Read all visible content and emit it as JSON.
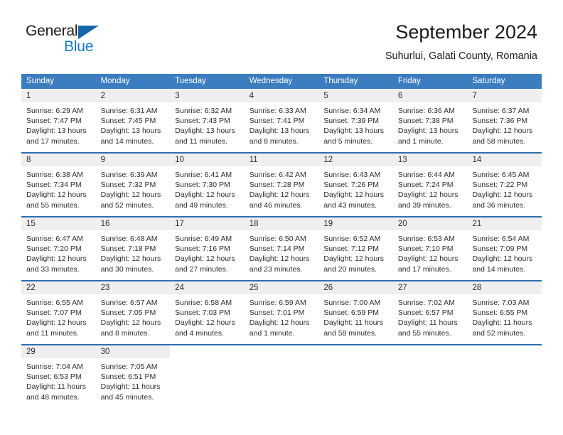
{
  "brand": {
    "word1": "General",
    "word2": "Blue",
    "flag_icon": "triangle-flag-icon",
    "accent_color": "#1878c8"
  },
  "header": {
    "title": "September 2024",
    "subtitle": "Suhurlui, Galati County, Romania"
  },
  "theme": {
    "header_blue": "#3b7dbf",
    "row_border_blue": "#2f6fb0",
    "daynum_band": "#efefef"
  },
  "weekdays": [
    "Sunday",
    "Monday",
    "Tuesday",
    "Wednesday",
    "Thursday",
    "Friday",
    "Saturday"
  ],
  "weeks": [
    [
      {
        "day": "1",
        "sunrise": "Sunrise: 6:29 AM",
        "sunset": "Sunset: 7:47 PM",
        "daylight1": "Daylight: 13 hours",
        "daylight2": "and 17 minutes."
      },
      {
        "day": "2",
        "sunrise": "Sunrise: 6:31 AM",
        "sunset": "Sunset: 7:45 PM",
        "daylight1": "Daylight: 13 hours",
        "daylight2": "and 14 minutes."
      },
      {
        "day": "3",
        "sunrise": "Sunrise: 6:32 AM",
        "sunset": "Sunset: 7:43 PM",
        "daylight1": "Daylight: 13 hours",
        "daylight2": "and 11 minutes."
      },
      {
        "day": "4",
        "sunrise": "Sunrise: 6:33 AM",
        "sunset": "Sunset: 7:41 PM",
        "daylight1": "Daylight: 13 hours",
        "daylight2": "and 8 minutes."
      },
      {
        "day": "5",
        "sunrise": "Sunrise: 6:34 AM",
        "sunset": "Sunset: 7:39 PM",
        "daylight1": "Daylight: 13 hours",
        "daylight2": "and 5 minutes."
      },
      {
        "day": "6",
        "sunrise": "Sunrise: 6:36 AM",
        "sunset": "Sunset: 7:38 PM",
        "daylight1": "Daylight: 13 hours",
        "daylight2": "and 1 minute."
      },
      {
        "day": "7",
        "sunrise": "Sunrise: 6:37 AM",
        "sunset": "Sunset: 7:36 PM",
        "daylight1": "Daylight: 12 hours",
        "daylight2": "and 58 minutes."
      }
    ],
    [
      {
        "day": "8",
        "sunrise": "Sunrise: 6:38 AM",
        "sunset": "Sunset: 7:34 PM",
        "daylight1": "Daylight: 12 hours",
        "daylight2": "and 55 minutes."
      },
      {
        "day": "9",
        "sunrise": "Sunrise: 6:39 AM",
        "sunset": "Sunset: 7:32 PM",
        "daylight1": "Daylight: 12 hours",
        "daylight2": "and 52 minutes."
      },
      {
        "day": "10",
        "sunrise": "Sunrise: 6:41 AM",
        "sunset": "Sunset: 7:30 PM",
        "daylight1": "Daylight: 12 hours",
        "daylight2": "and 49 minutes."
      },
      {
        "day": "11",
        "sunrise": "Sunrise: 6:42 AM",
        "sunset": "Sunset: 7:28 PM",
        "daylight1": "Daylight: 12 hours",
        "daylight2": "and 46 minutes."
      },
      {
        "day": "12",
        "sunrise": "Sunrise: 6:43 AM",
        "sunset": "Sunset: 7:26 PM",
        "daylight1": "Daylight: 12 hours",
        "daylight2": "and 43 minutes."
      },
      {
        "day": "13",
        "sunrise": "Sunrise: 6:44 AM",
        "sunset": "Sunset: 7:24 PM",
        "daylight1": "Daylight: 12 hours",
        "daylight2": "and 39 minutes."
      },
      {
        "day": "14",
        "sunrise": "Sunrise: 6:45 AM",
        "sunset": "Sunset: 7:22 PM",
        "daylight1": "Daylight: 12 hours",
        "daylight2": "and 36 minutes."
      }
    ],
    [
      {
        "day": "15",
        "sunrise": "Sunrise: 6:47 AM",
        "sunset": "Sunset: 7:20 PM",
        "daylight1": "Daylight: 12 hours",
        "daylight2": "and 33 minutes."
      },
      {
        "day": "16",
        "sunrise": "Sunrise: 6:48 AM",
        "sunset": "Sunset: 7:18 PM",
        "daylight1": "Daylight: 12 hours",
        "daylight2": "and 30 minutes."
      },
      {
        "day": "17",
        "sunrise": "Sunrise: 6:49 AM",
        "sunset": "Sunset: 7:16 PM",
        "daylight1": "Daylight: 12 hours",
        "daylight2": "and 27 minutes."
      },
      {
        "day": "18",
        "sunrise": "Sunrise: 6:50 AM",
        "sunset": "Sunset: 7:14 PM",
        "daylight1": "Daylight: 12 hours",
        "daylight2": "and 23 minutes."
      },
      {
        "day": "19",
        "sunrise": "Sunrise: 6:52 AM",
        "sunset": "Sunset: 7:12 PM",
        "daylight1": "Daylight: 12 hours",
        "daylight2": "and 20 minutes."
      },
      {
        "day": "20",
        "sunrise": "Sunrise: 6:53 AM",
        "sunset": "Sunset: 7:10 PM",
        "daylight1": "Daylight: 12 hours",
        "daylight2": "and 17 minutes."
      },
      {
        "day": "21",
        "sunrise": "Sunrise: 6:54 AM",
        "sunset": "Sunset: 7:09 PM",
        "daylight1": "Daylight: 12 hours",
        "daylight2": "and 14 minutes."
      }
    ],
    [
      {
        "day": "22",
        "sunrise": "Sunrise: 6:55 AM",
        "sunset": "Sunset: 7:07 PM",
        "daylight1": "Daylight: 12 hours",
        "daylight2": "and 11 minutes."
      },
      {
        "day": "23",
        "sunrise": "Sunrise: 6:57 AM",
        "sunset": "Sunset: 7:05 PM",
        "daylight1": "Daylight: 12 hours",
        "daylight2": "and 8 minutes."
      },
      {
        "day": "24",
        "sunrise": "Sunrise: 6:58 AM",
        "sunset": "Sunset: 7:03 PM",
        "daylight1": "Daylight: 12 hours",
        "daylight2": "and 4 minutes."
      },
      {
        "day": "25",
        "sunrise": "Sunrise: 6:59 AM",
        "sunset": "Sunset: 7:01 PM",
        "daylight1": "Daylight: 12 hours",
        "daylight2": "and 1 minute."
      },
      {
        "day": "26",
        "sunrise": "Sunrise: 7:00 AM",
        "sunset": "Sunset: 6:59 PM",
        "daylight1": "Daylight: 11 hours",
        "daylight2": "and 58 minutes."
      },
      {
        "day": "27",
        "sunrise": "Sunrise: 7:02 AM",
        "sunset": "Sunset: 6:57 PM",
        "daylight1": "Daylight: 11 hours",
        "daylight2": "and 55 minutes."
      },
      {
        "day": "28",
        "sunrise": "Sunrise: 7:03 AM",
        "sunset": "Sunset: 6:55 PM",
        "daylight1": "Daylight: 11 hours",
        "daylight2": "and 52 minutes."
      }
    ],
    [
      {
        "day": "29",
        "sunrise": "Sunrise: 7:04 AM",
        "sunset": "Sunset: 6:53 PM",
        "daylight1": "Daylight: 11 hours",
        "daylight2": "and 48 minutes."
      },
      {
        "day": "30",
        "sunrise": "Sunrise: 7:05 AM",
        "sunset": "Sunset: 6:51 PM",
        "daylight1": "Daylight: 11 hours",
        "daylight2": "and 45 minutes."
      },
      {
        "day": "",
        "sunrise": "",
        "sunset": "",
        "daylight1": "",
        "daylight2": ""
      },
      {
        "day": "",
        "sunrise": "",
        "sunset": "",
        "daylight1": "",
        "daylight2": ""
      },
      {
        "day": "",
        "sunrise": "",
        "sunset": "",
        "daylight1": "",
        "daylight2": ""
      },
      {
        "day": "",
        "sunrise": "",
        "sunset": "",
        "daylight1": "",
        "daylight2": ""
      },
      {
        "day": "",
        "sunrise": "",
        "sunset": "",
        "daylight1": "",
        "daylight2": ""
      }
    ]
  ]
}
